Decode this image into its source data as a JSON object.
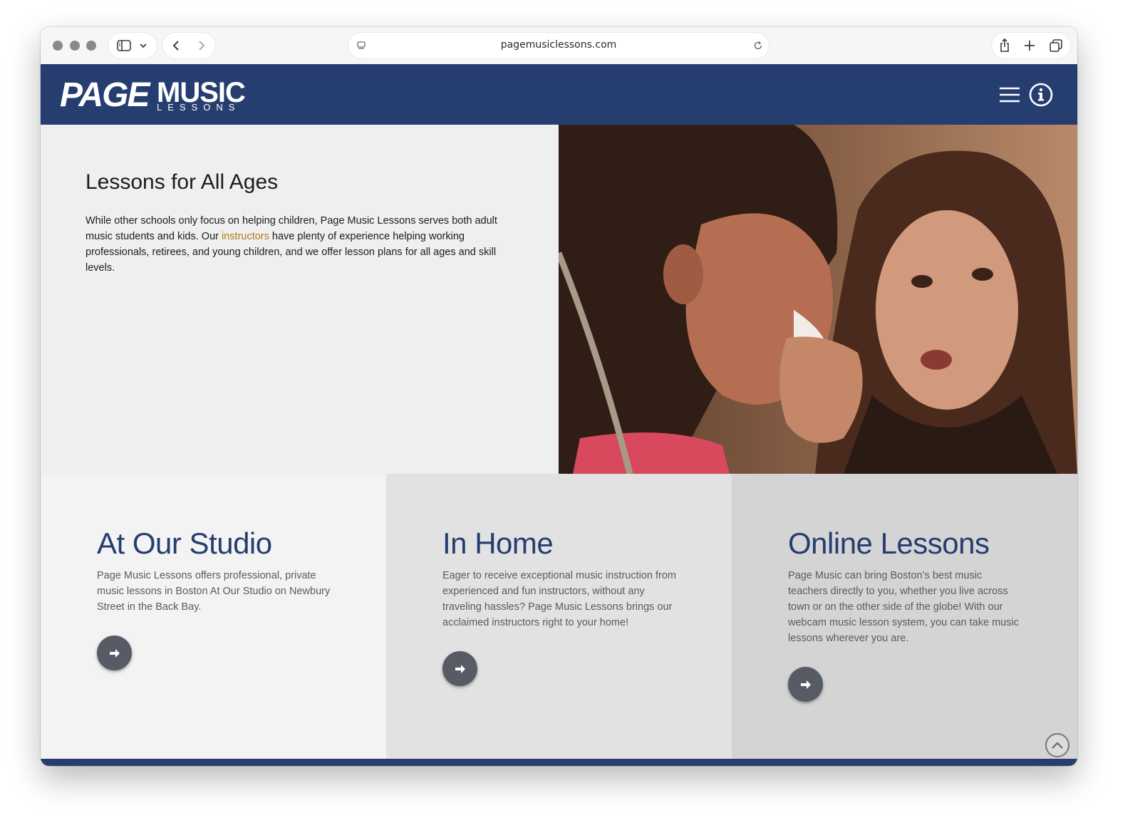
{
  "browser": {
    "url": "pagemusiclessons.com",
    "icons": [
      "sidebar-icon",
      "chevron-down-icon",
      "back-icon",
      "forward-icon",
      "page-icon",
      "reload-icon",
      "share-icon",
      "plus-icon",
      "tabs-icon"
    ]
  },
  "header": {
    "logo": {
      "word1": "PAGE",
      "word2": "MUSIC",
      "word3": "LESSONS"
    },
    "icons": [
      "menu-icon",
      "info-icon"
    ],
    "background": "#263d70"
  },
  "hero": {
    "title": "Lessons for All Ages",
    "body_before": "While other schools only focus on helping children, Page Music Lessons serves both adult music students and kids. Our ",
    "body_link": "instructors",
    "body_after": " have plenty of experience helping working professionals, retirees, and young children, and we offer lesson plans for all ages and skill levels.",
    "link_color": "#b07a1e"
  },
  "cards": [
    {
      "title": "At Our Studio",
      "text": "Page Music Lessons offers professional, private music lessons in Boston At Our Studio on Newbury Street in the Back Bay.",
      "background": "#f3f3f3"
    },
    {
      "title": "In Home",
      "text": "Eager to receive exceptional music instruction from experienced and fun instructors, without any traveling hassles? Page Music Lessons brings our acclaimed instructors right to your home!",
      "background": "#e2e2e2"
    },
    {
      "title": "Online Lessons",
      "text": "Page Music can bring Boston’s best music teachers directly to you, whether you live across town or on the other side of the globe! With our webcam music lesson system, you can take music lessons wherever you are.",
      "background": "#d4d4d4"
    }
  ],
  "colors": {
    "brand_navy": "#263d70",
    "button_gray": "#565b66"
  }
}
